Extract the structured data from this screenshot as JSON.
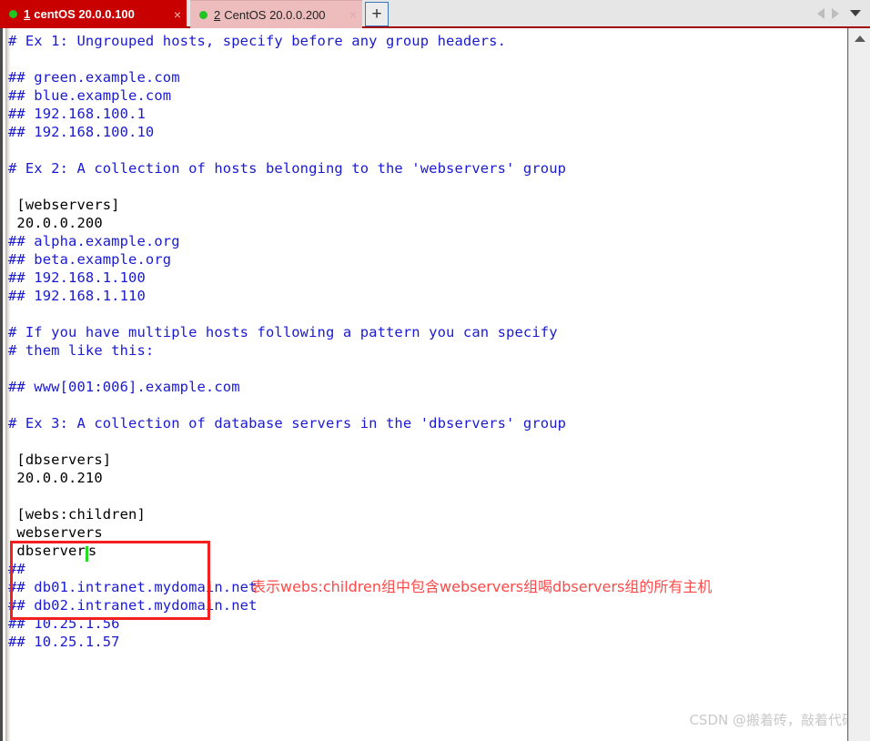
{
  "window": {
    "type": "terminal-emulator",
    "accent_color": "#c80000"
  },
  "tabbar": {
    "tabs": [
      {
        "index": "1",
        "title": "centOS 20.0.0.100",
        "status_dot": "green-dot-icon",
        "close_label": "×",
        "active": true
      },
      {
        "index": "2",
        "title": "CentOS 20.0.0.200",
        "status_dot": "green-dot-icon",
        "close_label": "×",
        "active": false
      }
    ],
    "new_tab_label": "+",
    "controls": {
      "prev_label": "prev-tab-arrow",
      "next_label": "next-tab-arrow",
      "menu_label": "tab-list-chevron"
    }
  },
  "terminal": {
    "lines": [
      {
        "text": "# Ex 1: Ungrouped hosts, specify before any group headers.",
        "color": "blue"
      },
      {
        "text": "",
        "color": "blue"
      },
      {
        "text": "## green.example.com",
        "color": "blue"
      },
      {
        "text": "## blue.example.com",
        "color": "blue"
      },
      {
        "text": "## 192.168.100.1",
        "color": "blue"
      },
      {
        "text": "## 192.168.100.10",
        "color": "blue"
      },
      {
        "text": "",
        "color": "blue"
      },
      {
        "text": "# Ex 2: A collection of hosts belonging to the 'webservers' group",
        "color": "blue"
      },
      {
        "text": "",
        "color": "blue"
      },
      {
        "text": " [webservers]",
        "color": "black"
      },
      {
        "text": " 20.0.0.200",
        "color": "black"
      },
      {
        "text": "## alpha.example.org",
        "color": "blue"
      },
      {
        "text": "## beta.example.org",
        "color": "blue"
      },
      {
        "text": "## 192.168.1.100",
        "color": "blue"
      },
      {
        "text": "## 192.168.1.110",
        "color": "blue"
      },
      {
        "text": "",
        "color": "blue"
      },
      {
        "text": "# If you have multiple hosts following a pattern you can specify",
        "color": "blue"
      },
      {
        "text": "# them like this:",
        "color": "blue"
      },
      {
        "text": "",
        "color": "blue"
      },
      {
        "text": "## www[001:006].example.com",
        "color": "blue"
      },
      {
        "text": "",
        "color": "blue"
      },
      {
        "text": "# Ex 3: A collection of database servers in the 'dbservers' group",
        "color": "blue"
      },
      {
        "text": "",
        "color": "blue"
      },
      {
        "text": " [dbservers]",
        "color": "black"
      },
      {
        "text": " 20.0.0.210",
        "color": "black"
      },
      {
        "text": "",
        "color": "black"
      },
      {
        "text": " [webs:children]",
        "color": "black"
      },
      {
        "text": " webservers",
        "color": "black"
      },
      {
        "text": " dbservers",
        "color": "black",
        "cursor_after": true
      },
      {
        "text": "##",
        "color": "blue"
      },
      {
        "text": "## db01.intranet.mydomain.net",
        "color": "blue"
      },
      {
        "text": "## db02.intranet.mydomain.net",
        "color": "blue"
      },
      {
        "text": "## 10.25.1.56",
        "color": "blue"
      },
      {
        "text": "## 10.25.1.57",
        "color": "blue"
      }
    ],
    "cursor_color": "#22dd22"
  },
  "highlight_box": {
    "color": "#f42020",
    "encloses": "[webs:children] webservers dbservers"
  },
  "annotation": {
    "text": "表示webs:children组中包含webservers组喝dbservers组的所有主机",
    "color": "#fb4a4a"
  },
  "watermark": {
    "text": "CSDN @搬着砖，敲着代码",
    "color": "#c9c9c9"
  },
  "scrollbar": {
    "up_arrow": "scroll-up-arrow-icon"
  }
}
